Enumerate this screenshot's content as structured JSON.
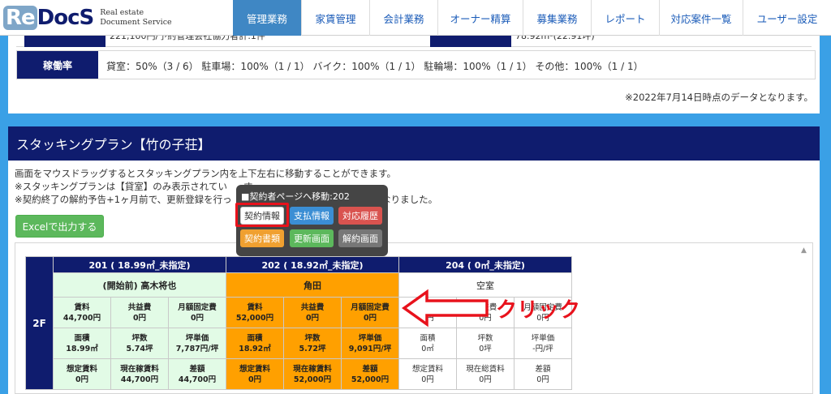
{
  "header": {
    "logo_re": "Re",
    "logo_docs": "DocS",
    "logo_sub1": "Real estate",
    "logo_sub2": "Document Service",
    "nav": [
      {
        "label": "管理業務",
        "active": true
      },
      {
        "label": "家賃管理"
      },
      {
        "label": "会計業務"
      },
      {
        "label": "オーナー精算"
      },
      {
        "label": "募集業務"
      },
      {
        "label": "レポート"
      },
      {
        "label": "対応案件一覧"
      },
      {
        "label": "ユーザー設定"
      }
    ]
  },
  "summary": {
    "partial_text_left": "221,100円/予約管理会社協力者計:1件",
    "partial_text_right": "78.92m²(22.91坪)",
    "occupancy_label": "稼働率",
    "occupancy_value": "貸室：50%（3 / 6） 駐車場：100%（1 / 1） バイク：100%（1 / 1） 駐輪場：100%（1 / 1） その他：100%（1 / 1）",
    "data_note": "※2022年7月14日時点のデータとなります。"
  },
  "stacking": {
    "title": "スタッキングプラン【竹の子荘】",
    "note1": "画面をマウスドラッグするとスタッキングプラン内を上下左右に移動することができます。",
    "note2": "※スタッキングプランは【貸室】のみ表示されてい",
    "note2b": "す。",
    "note3": "※契約終了の解約予告+1ヶ月前で、更新登録を行っ",
    "note3b": "示されるようになりました。",
    "excel_button": "Excelで出力する",
    "floor": "2F",
    "rooms": [
      {
        "header": "201 ( 18.99㎡_未指定)",
        "tenant": "(開始前) 高木将也",
        "rent_l": "賃料",
        "rent_v": "44,700円",
        "common_l": "共益費",
        "common_v": "0円",
        "fixed_l": "月額固定費",
        "fixed_v": "0円",
        "area_l": "面積",
        "area_v": "18.99㎡",
        "tsubo_l": "坪数",
        "tsubo_v": "5.74坪",
        "unit_l": "坪単価",
        "unit_v": "7,787円/坪",
        "assumed_l": "想定賃料",
        "assumed_v": "0円",
        "current_l": "現在稼賃料",
        "current_v": "44,700円",
        "diff_l": "差額",
        "diff_v": "44,700円"
      },
      {
        "header": "202 ( 18.92㎡_未指定)",
        "tenant": "角田",
        "rent_l": "賃料",
        "rent_v": "52,000円",
        "common_l": "共益費",
        "common_v": "0円",
        "fixed_l": "月額固定費",
        "fixed_v": "0円",
        "area_l": "面積",
        "area_v": "18.92㎡",
        "tsubo_l": "坪数",
        "tsubo_v": "5.72坪",
        "unit_l": "坪単価",
        "unit_v": "9,091円/坪",
        "assumed_l": "想定賃料",
        "assumed_v": "0円",
        "current_l": "現在稼賃料",
        "current_v": "52,000円",
        "diff_l": "差額",
        "diff_v": "52,000円"
      },
      {
        "header": "204 ( 0㎡_未指定)",
        "tenant": "空室",
        "rent_l": "賃料",
        "rent_v": "0円",
        "common_l": "共益費",
        "common_v": "0円",
        "fixed_l": "月額固定費",
        "fixed_v": "0円",
        "area_l": "面積",
        "area_v": "0㎡",
        "tsubo_l": "坪数",
        "tsubo_v": "0坪",
        "unit_l": "坪単価",
        "unit_v": "-円/坪",
        "assumed_l": "想定賃料",
        "assumed_v": "0円",
        "current_l": "現在総賃料",
        "current_v": "0円",
        "diff_l": "差額",
        "diff_v": "0円"
      }
    ]
  },
  "popup": {
    "title": "■契約者ページへ移動:202",
    "btn_contract": "契約情報",
    "btn_payment": "支払情報",
    "btn_history": "対応履歴",
    "btn_docs": "契約書類",
    "btn_renew": "更新画面",
    "btn_cancel": "解約画面"
  },
  "annotation": {
    "click_label": "クリック",
    "color": "#e8121c"
  },
  "colors": {
    "navy": "#0f1c6e",
    "frame_blue": "#3aa0e6",
    "active_nav": "#3f87c4",
    "room_green": "#e2fbe6",
    "room_orange": "#ffa000"
  }
}
